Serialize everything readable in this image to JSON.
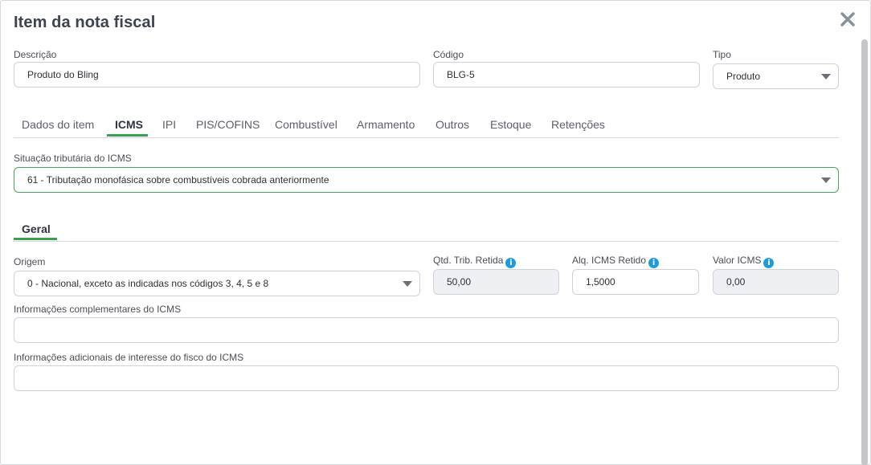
{
  "modal": {
    "title": "Item da nota fiscal"
  },
  "descricao": {
    "label": "Descrição",
    "value": "Produto do Bling"
  },
  "codigo": {
    "label": "Código",
    "value": "BLG-5"
  },
  "tipo": {
    "label": "Tipo",
    "value": "Produto"
  },
  "tabs": [
    {
      "label": "Dados do item"
    },
    {
      "label": "ICMS",
      "active": true
    },
    {
      "label": "IPI"
    },
    {
      "label": "PIS/COFINS"
    },
    {
      "label": "Combustível"
    },
    {
      "label": "Armamento"
    },
    {
      "label": "Outros"
    },
    {
      "label": "Estoque"
    },
    {
      "label": "Retenções"
    }
  ],
  "situacao": {
    "label": "Situação tributária do ICMS",
    "value": "61 - Tributação monofásica sobre combustíveis cobrada anteriormente"
  },
  "subtab": {
    "label": "Geral"
  },
  "origem": {
    "label": "Origem",
    "value": "0 - Nacional, exceto as indicadas nos códigos 3, 4, 5 e 8"
  },
  "qtd_trib": {
    "label": "Qtd. Trib. Retida",
    "value": "50,00"
  },
  "aliq": {
    "label": "Alq. ICMS Retido",
    "value": "1,5000"
  },
  "valor": {
    "label": "Valor ICMS",
    "value": "0,00"
  },
  "info_compl": {
    "label": "Informações complementares do ICMS",
    "value": ""
  },
  "info_fisco": {
    "label": "Informações adicionais de interesse do fisco do ICMS",
    "value": ""
  },
  "colors": {
    "accent": "#3aa14c",
    "info": "#1f9bd8"
  },
  "icons": {
    "close": "close-icon",
    "info": "info-icon",
    "dropdown": "chevron-down-icon"
  }
}
